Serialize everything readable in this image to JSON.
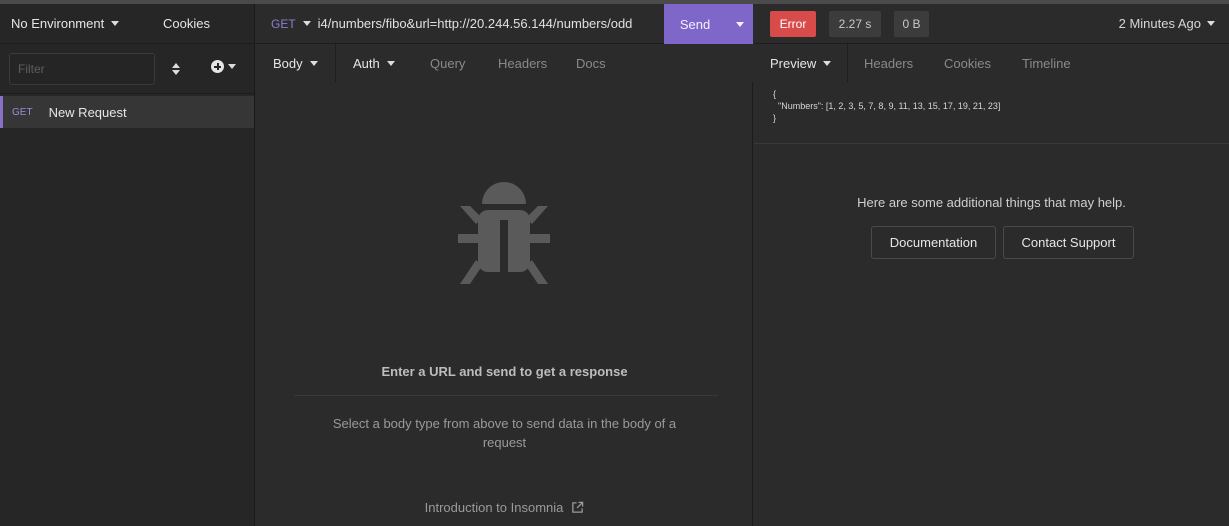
{
  "sidebar": {
    "environment": "No Environment",
    "cookies": "Cookies",
    "filter_placeholder": "Filter",
    "requests": [
      {
        "method": "GET",
        "name": "New Request"
      }
    ]
  },
  "urlbar": {
    "method": "GET",
    "url": "i4/numbers/fibo&url=http://20.244.56.144/numbers/odd",
    "send_label": "Send"
  },
  "request_tabs": {
    "body": "Body",
    "auth": "Auth",
    "query": "Query",
    "headers": "Headers",
    "docs": "Docs"
  },
  "request_pane": {
    "empty_title": "Enter a URL and send to get a response",
    "empty_desc": "Select a body type from above to send data in the body of a request",
    "intro_link": "Introduction to Insomnia"
  },
  "response": {
    "status": "Error",
    "time": "2.27 s",
    "size": "0 B",
    "ago": "2 Minutes Ago",
    "tabs": {
      "preview": "Preview",
      "headers": "Headers",
      "cookies": "Cookies",
      "timeline": "Timeline"
    },
    "json_open": "{",
    "json_body": "\"Numbers\": [1, 2, 3, 5, 7, 8, 9, 11, 13, 15, 17, 19, 21, 23]",
    "json_close": "}",
    "help_text": "Here are some additional things that may help.",
    "documentation_button": "Documentation",
    "support_button": "Contact Support"
  },
  "colors": {
    "accent": "#7e67c8",
    "error": "#d84b4b",
    "background": "#2b2b2b",
    "sidebar": "#262626"
  },
  "icons": [
    "caret-down-icon",
    "sort-icon",
    "plus-circle-icon",
    "bug-icon",
    "external-link-icon"
  ]
}
